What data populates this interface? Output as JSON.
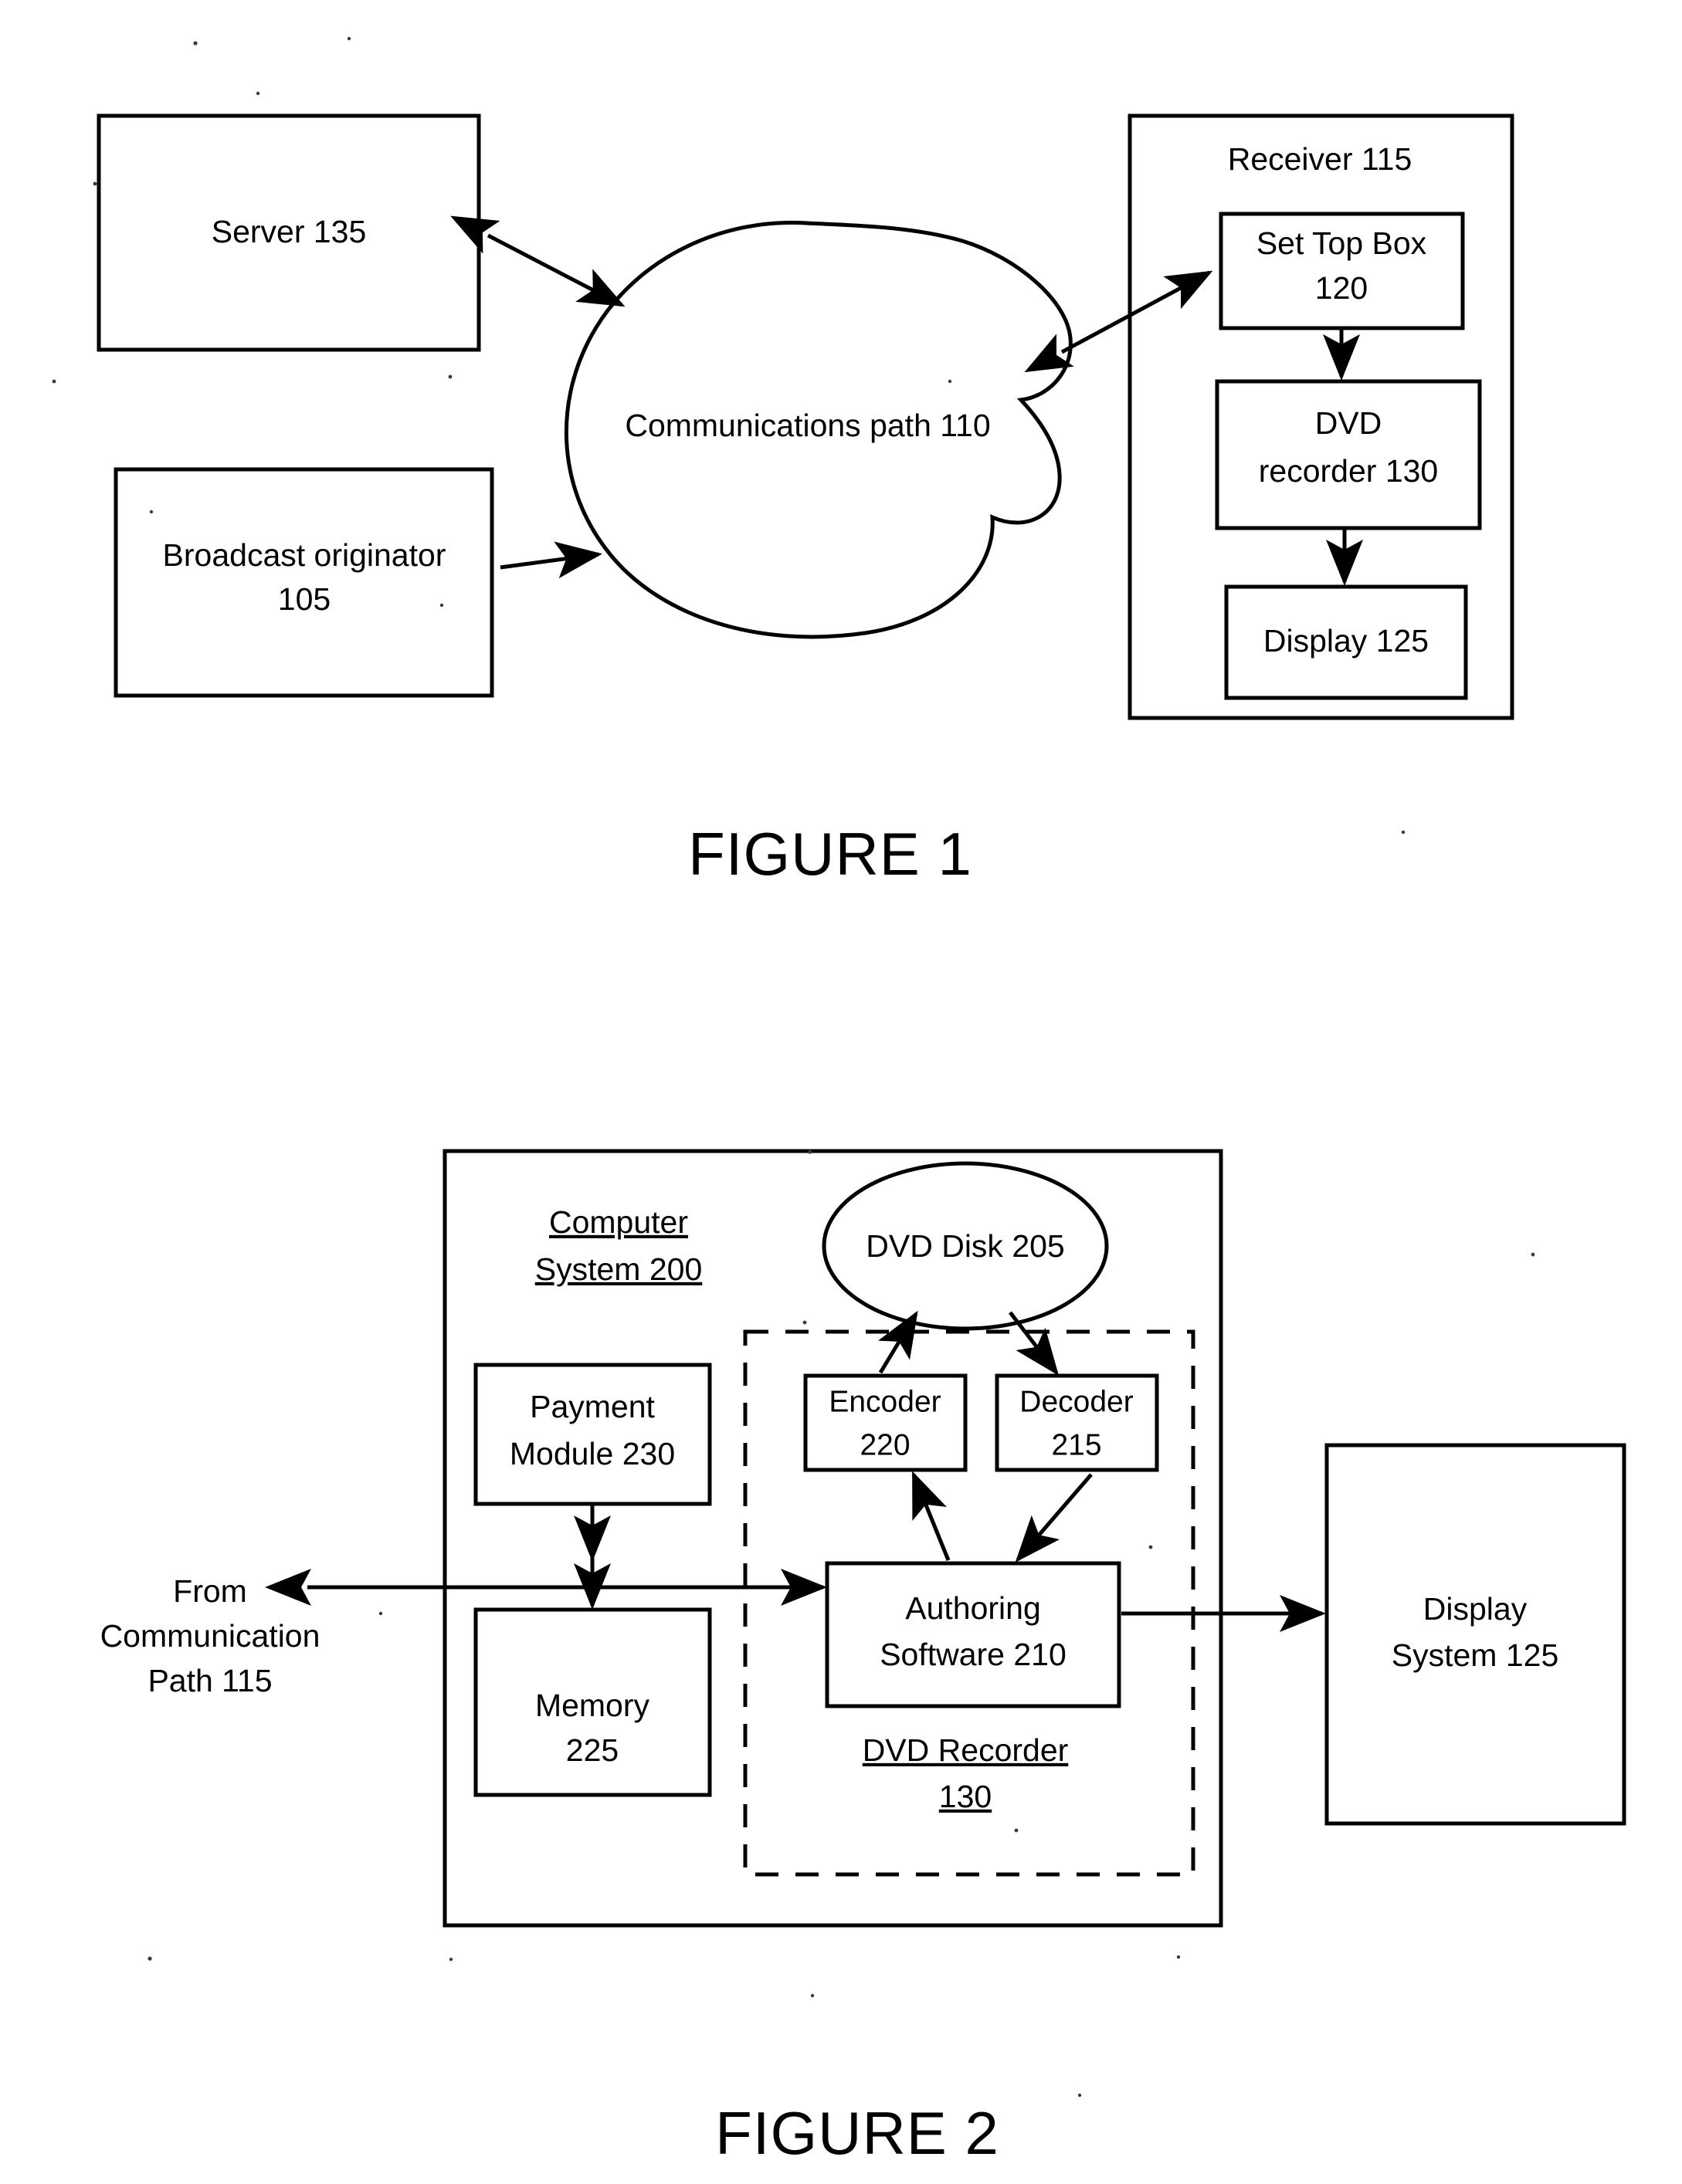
{
  "document": {
    "type": "patent-drawing-sheet",
    "figures": [
      {
        "caption": "FIGURE 1",
        "nodes": {
          "server": "Server 135",
          "broadcast_originator_line1": "Broadcast originator",
          "broadcast_originator_line2": "105",
          "communications_path": "Communications path 110",
          "receiver_title": "Receiver 115",
          "set_top_box_line1": "Set Top Box",
          "set_top_box_line2": "120",
          "dvd_recorder_line1": "DVD",
          "dvd_recorder_line2": "recorder 130",
          "display": "Display 125"
        },
        "connections": [
          {
            "from": "Server 135",
            "to": "Communications path 110",
            "style": "double-arrow"
          },
          {
            "from": "Broadcast originator 105",
            "to": "Communications path 110",
            "style": "single-arrow"
          },
          {
            "from": "Communications path 110",
            "to": "Set Top Box 120",
            "style": "double-arrow"
          },
          {
            "from": "Set Top Box 120",
            "to": "DVD recorder 130",
            "style": "single-arrow"
          },
          {
            "from": "DVD recorder 130",
            "to": "Display 125",
            "style": "single-arrow"
          }
        ]
      },
      {
        "caption": "FIGURE 2",
        "nodes": {
          "computer_system_line1": "Computer",
          "computer_system_line2": "System 200",
          "dvd_disk": "DVD Disk 205",
          "encoder_line1": "Encoder",
          "encoder_line2": "220",
          "decoder_line1": "Decoder",
          "decoder_line2": "215",
          "payment_module_line1": "Payment",
          "payment_module_line2": "Module 230",
          "memory_line1": "Memory",
          "memory_line2": "225",
          "authoring_software_line1": "Authoring",
          "authoring_software_line2": "Software 210",
          "dvd_recorder_label_line1": "DVD Recorder",
          "dvd_recorder_label_line2": "130",
          "from_communication_line1": "From",
          "from_communication_line2": "Communication",
          "from_communication_line3": "Path 115",
          "display_system_line1": "Display",
          "display_system_line2": "System 125"
        },
        "connections": [
          {
            "from": "Encoder 220",
            "to": "DVD Disk 205",
            "style": "single-arrow"
          },
          {
            "from": "DVD Disk 205",
            "to": "Decoder 215",
            "style": "single-arrow"
          },
          {
            "from": "Authoring Software 210",
            "to": "Encoder 220",
            "style": "single-arrow"
          },
          {
            "from": "Decoder 215",
            "to": "Authoring Software 210",
            "style": "single-arrow"
          },
          {
            "from": "Payment Module 230",
            "to": "Memory 225",
            "style": "single-arrow"
          },
          {
            "from": "From Communication Path 115",
            "to": "Authoring Software 210",
            "style": "double-arrow"
          },
          {
            "from": "Authoring Software 210",
            "to": "Display System 125",
            "style": "single-arrow"
          }
        ]
      }
    ]
  },
  "colors": {
    "ink": "#000000",
    "paper": "#ffffff"
  }
}
